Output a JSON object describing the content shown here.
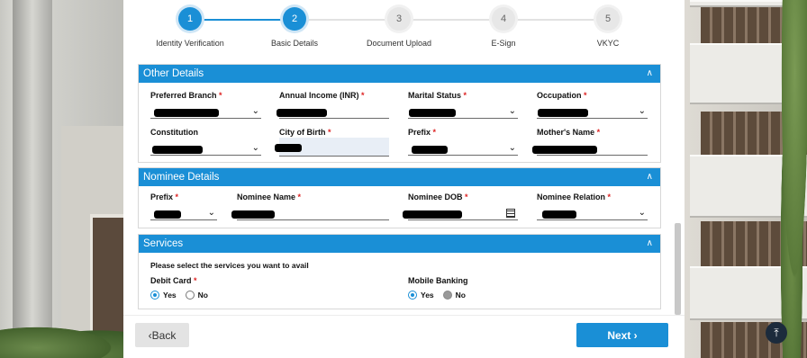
{
  "stepper": {
    "steps": [
      {
        "number": "1",
        "label": "Identity Verification",
        "state": "active"
      },
      {
        "number": "2",
        "label": "Basic Details",
        "state": "active"
      },
      {
        "number": "3",
        "label": "Document Upload",
        "state": "inactive"
      },
      {
        "number": "4",
        "label": "E-Sign",
        "state": "inactive"
      },
      {
        "number": "5",
        "label": "VKYC",
        "state": "inactive"
      }
    ]
  },
  "other_details": {
    "title": "Other Details",
    "collapse_icon": "chevron-up-icon",
    "fields": {
      "preferred_branch": {
        "label": "Preferred Branch",
        "required": "*"
      },
      "annual_income": {
        "label": "Annual Income (INR)",
        "required": "*"
      },
      "marital_status": {
        "label": "Marital Status",
        "required": "*"
      },
      "occupation": {
        "label": "Occupation",
        "required": "*"
      },
      "constitution": {
        "label": "Constitution",
        "required": ""
      },
      "city_of_birth": {
        "label": "City of Birth",
        "required": "*"
      },
      "prefix": {
        "label": "Prefix",
        "required": "*"
      },
      "mothers_name": {
        "label": "Mother's Name",
        "required": "*"
      }
    }
  },
  "nominee_details": {
    "title": "Nominee Details",
    "collapse_icon": "chevron-up-icon",
    "fields": {
      "prefix": {
        "label": "Prefix",
        "required": "*"
      },
      "nominee_name": {
        "label": "Nominee Name",
        "required": "*"
      },
      "nominee_dob": {
        "label": "Nominee DOB",
        "required": "*"
      },
      "nominee_relation": {
        "label": "Nominee Relation",
        "required": "*"
      }
    }
  },
  "services": {
    "title": "Services",
    "collapse_icon": "chevron-up-icon",
    "question": "Please select the services you want to avail",
    "debit_card": {
      "label": "Debit Card",
      "required": "*",
      "yes": "Yes",
      "no": "No",
      "selected": "Yes"
    },
    "mobile_banking": {
      "label": "Mobile Banking",
      "yes": "Yes",
      "no": "No",
      "selected": "Yes"
    }
  },
  "footer": {
    "back_label": "Back",
    "back_icon": "chevron-left-icon",
    "next_label": "Next",
    "next_icon": "chevron-right-icon"
  },
  "scroll_top_icon": "arrow-to-top-icon",
  "colors": {
    "accent": "#1a8fd6",
    "required": "#d22222"
  }
}
